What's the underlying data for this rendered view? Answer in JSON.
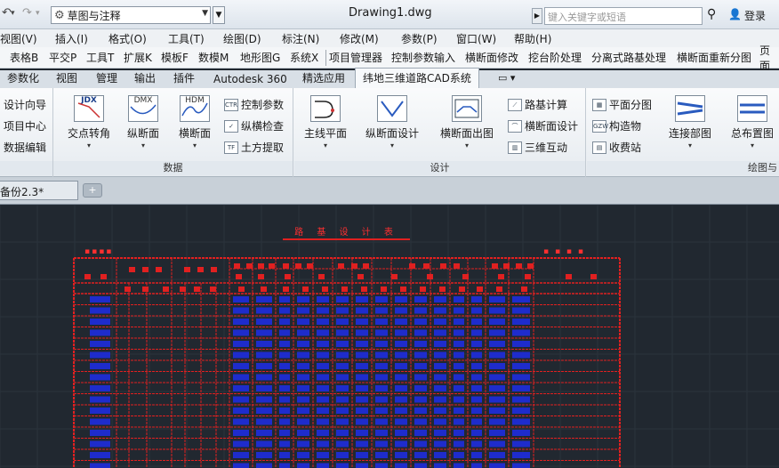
{
  "titlebar": {
    "workspace": "草图与注释",
    "document_title": "Drawing1.dwg",
    "search_placeholder": "键入关键字或短语",
    "login": "登录"
  },
  "menubar": {
    "items": [
      "视图(V)",
      "插入(I)",
      "格式(O)",
      "工具(T)",
      "绘图(D)",
      "标注(N)",
      "修改(M)",
      "参数(P)",
      "窗口(W)",
      "帮助(H)"
    ]
  },
  "toolbar": {
    "items": [
      "表格B",
      "平交P",
      "工具T",
      "扩展K",
      "模板F",
      "数模M",
      "地形图G",
      "系统X",
      "项目管理器",
      "控制参数输入",
      "横断面修改",
      "挖台阶处理",
      "分离式路基处理",
      "横断面重新分图",
      "页面"
    ]
  },
  "ribbon_tabs": {
    "items": [
      "参数化",
      "视图",
      "管理",
      "输出",
      "插件",
      "Autodesk 360",
      "精选应用",
      "纬地三维道路CAD系统"
    ],
    "active_index": 7
  },
  "ribbon": {
    "panel0": {
      "items": [
        "设计向导",
        "项目中心",
        "数据编辑"
      ]
    },
    "data_panel": {
      "title": "数据",
      "large": [
        {
          "label": "交点转角",
          "icon": "JDX"
        },
        {
          "label": "纵断面",
          "icon": "DMX"
        },
        {
          "label": "横断面",
          "icon": "HDM"
        }
      ],
      "small": [
        {
          "label": "控制参数",
          "icon": "CTR"
        },
        {
          "label": "纵横检查",
          "icon": "chk"
        },
        {
          "label": "土方提取",
          "icon": "TF"
        }
      ]
    },
    "design_panel": {
      "title": "设计",
      "large": [
        {
          "label": "主线平面"
        },
        {
          "label": "纵断面设计"
        },
        {
          "label": "横断面出图"
        }
      ],
      "small": [
        {
          "label": "路基计算"
        },
        {
          "label": "横断面设计"
        },
        {
          "label": "三维互动"
        }
      ]
    },
    "draw_panel": {
      "title": "绘图与",
      "small": [
        {
          "label": "平面分图"
        },
        {
          "label": "构造物"
        },
        {
          "label": "收费站"
        }
      ],
      "large": [
        {
          "label": "连接部图"
        },
        {
          "label": "总布置图"
        }
      ]
    }
  },
  "doctabs": {
    "active": "备份2.3*"
  },
  "drawing": {
    "title": "路 基 设 计 表"
  },
  "colors": {
    "canvas": "#212830",
    "cad_red": "#e02020",
    "cad_blue": "#1e2ccc"
  }
}
